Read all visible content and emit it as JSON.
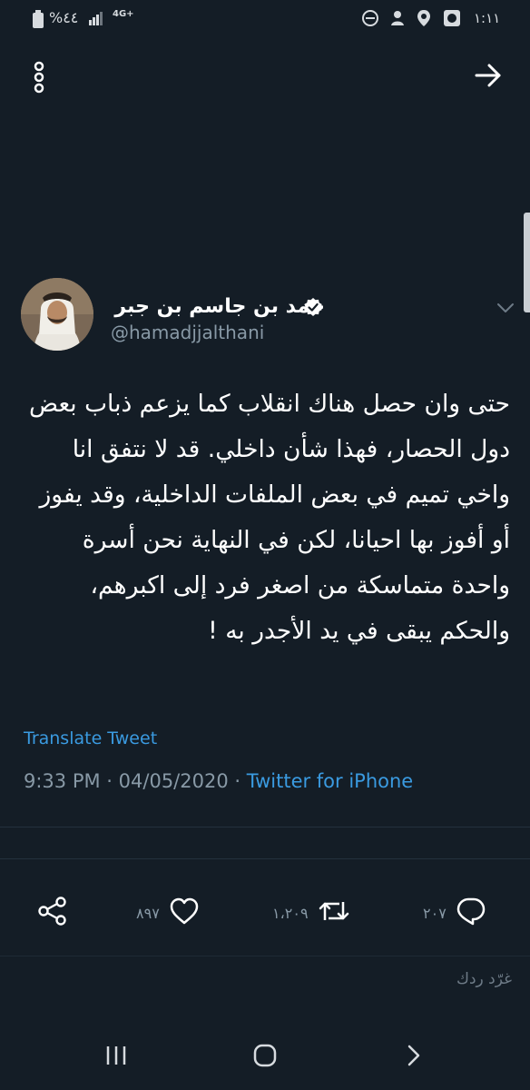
{
  "status_bar": {
    "time": "١:١١",
    "battery": "%٤٤",
    "network": "4G+"
  },
  "app_bar": {
    "back_icon": "arrow-right-icon",
    "more_icon": "more-vertical-icon"
  },
  "tweet": {
    "author_name": "حمد بن جاسم بن جبر",
    "handle": "@hamadjjalthani",
    "verified": true,
    "text": "حتى وان حصل هناك انقلاب كما يزعم ذباب بعض دول الحصار، فهذا شأن داخلي. قد لا نتفق انا واخي تميم في بعض الملفات الداخلية، وقد يفوز أو أفوز بها احيانا، لكن في النهاية نحن أسرة واحدة متماسكة من اصغر فرد إلى اكبرهم، والحكم يبقى في يد الأجدر به !",
    "translate_label": "Translate Tweet",
    "time": "9:33 PM",
    "separator": " · ",
    "date": "04/05/2020",
    "source": "Twitter for iPhone"
  },
  "actions": {
    "reply_count": "٢٠٧",
    "retweet_count": "١،٢٠٩",
    "like_count": "٨٩٧"
  },
  "reply_placeholder": "غرّد ردك",
  "colors": {
    "background": "#141d26",
    "accent": "#3a9ae0",
    "secondary_text": "#8899a6"
  }
}
